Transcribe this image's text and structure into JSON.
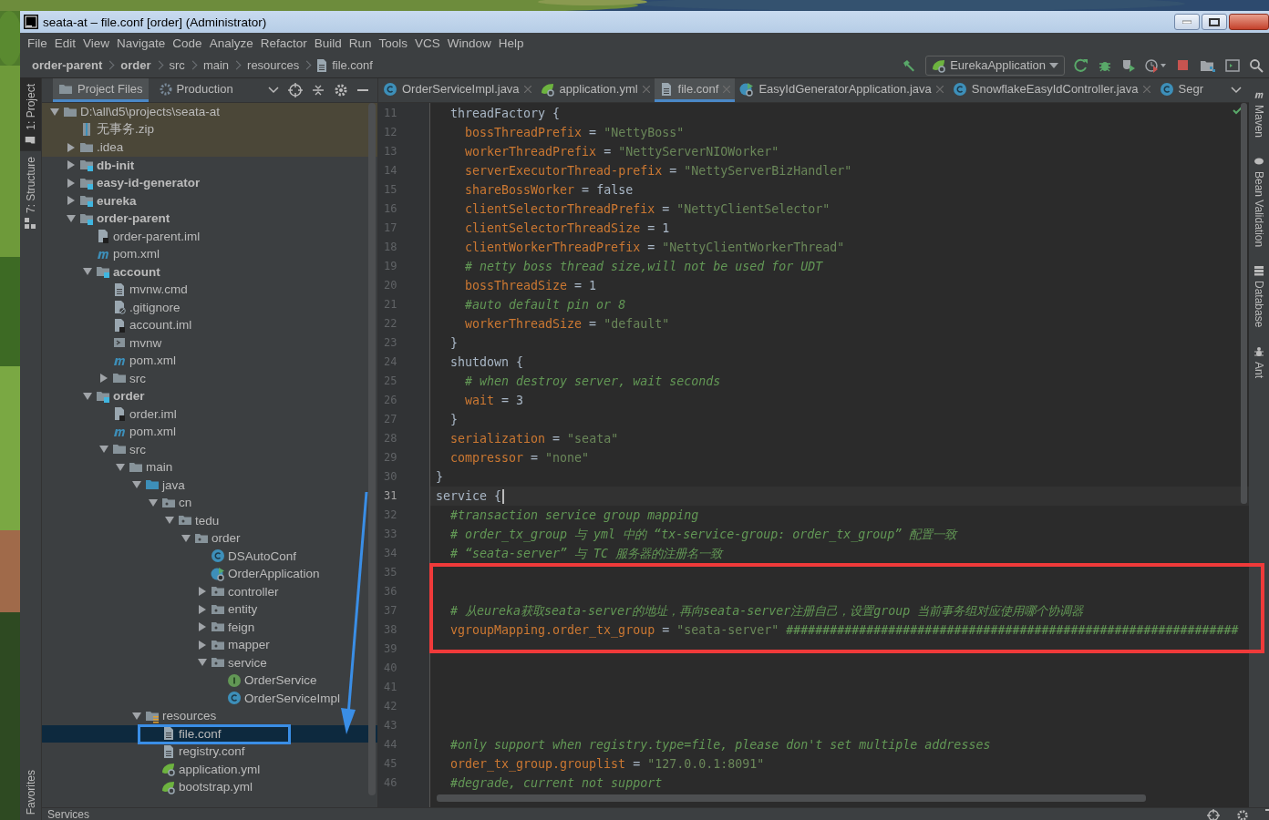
{
  "window": {
    "title": "seata-at – file.conf [order] (Administrator)"
  },
  "menu": [
    "File",
    "Edit",
    "View",
    "Navigate",
    "Code",
    "Analyze",
    "Refactor",
    "Build",
    "Run",
    "Tools",
    "VCS",
    "Window",
    "Help"
  ],
  "breadcrumbs": [
    {
      "label": "order-parent",
      "kind": "module"
    },
    {
      "label": "order",
      "kind": "module"
    },
    {
      "label": "src",
      "kind": "folder"
    },
    {
      "label": "main",
      "kind": "folder"
    },
    {
      "label": "resources",
      "kind": "folder"
    },
    {
      "label": "file.conf",
      "kind": "file"
    }
  ],
  "run_configuration": "EurekaApplication",
  "left_tool_strip": [
    {
      "label": "1: Project",
      "kind": "project",
      "selected": true
    },
    {
      "label": "7: Structure",
      "kind": "structure",
      "selected": false
    }
  ],
  "left_tool_strip_bottom": [
    {
      "label": "Favorites",
      "selected": false
    }
  ],
  "right_tool_strip": [
    {
      "label": "Maven",
      "kind": "maven"
    },
    {
      "label": "Bean Validation",
      "kind": "bean"
    },
    {
      "label": "Database",
      "kind": "database"
    },
    {
      "label": "Ant",
      "kind": "ant"
    }
  ],
  "project_panel": {
    "tabs": [
      {
        "label": "Project Files",
        "selected": true
      },
      {
        "label": "Production",
        "selected": false
      }
    ],
    "tree": [
      {
        "label": "D:\\all\\d5\\projects\\seata-at",
        "kind": "folder",
        "expanded": true,
        "highlighted": true,
        "selected": false,
        "children": [
          {
            "label": "无事务.zip",
            "kind": "zip",
            "highlighted": true,
            "selected": false
          },
          {
            "label": ".idea",
            "kind": "folder",
            "expanded": false,
            "highlighted": true,
            "selected": false
          },
          {
            "label": "db-init",
            "kind": "module",
            "expanded": false,
            "highlighted": false,
            "selected": false
          },
          {
            "label": "easy-id-generator",
            "kind": "module",
            "expanded": false,
            "highlighted": false,
            "selected": false
          },
          {
            "label": "eureka",
            "kind": "module",
            "expanded": false,
            "highlighted": false,
            "selected": false
          },
          {
            "label": "order-parent",
            "kind": "module",
            "expanded": true,
            "highlighted": false,
            "selected": false,
            "children": [
              {
                "label": "order-parent.iml",
                "kind": "iml",
                "highlighted": false,
                "selected": false
              },
              {
                "label": "pom.xml",
                "kind": "maven",
                "highlighted": false,
                "selected": false
              },
              {
                "label": "account",
                "kind": "module",
                "expanded": true,
                "highlighted": false,
                "selected": false,
                "children": [
                  {
                    "label": "mvnw.cmd",
                    "kind": "text",
                    "highlighted": false,
                    "selected": false
                  },
                  {
                    "label": ".gitignore",
                    "kind": "ignore",
                    "highlighted": false,
                    "selected": false
                  },
                  {
                    "label": "account.iml",
                    "kind": "iml",
                    "highlighted": false,
                    "selected": false
                  },
                  {
                    "label": "mvnw",
                    "kind": "script",
                    "highlighted": false,
                    "selected": false
                  },
                  {
                    "label": "pom.xml",
                    "kind": "maven",
                    "highlighted": false,
                    "selected": false
                  },
                  {
                    "label": "src",
                    "kind": "folder",
                    "expanded": false,
                    "highlighted": false,
                    "selected": false
                  }
                ]
              },
              {
                "label": "order",
                "kind": "module",
                "expanded": true,
                "highlighted": false,
                "selected": false,
                "children": [
                  {
                    "label": "order.iml",
                    "kind": "iml",
                    "highlighted": false,
                    "selected": false
                  },
                  {
                    "label": "pom.xml",
                    "kind": "maven",
                    "highlighted": false,
                    "selected": false
                  },
                  {
                    "label": "src",
                    "kind": "folder",
                    "expanded": true,
                    "highlighted": false,
                    "selected": false,
                    "children": [
                      {
                        "label": "main",
                        "kind": "folder",
                        "expanded": true,
                        "highlighted": false,
                        "selected": false,
                        "children": [
                          {
                            "label": "java",
                            "kind": "source",
                            "expanded": true,
                            "highlighted": false,
                            "selected": false,
                            "children": [
                              {
                                "label": "cn",
                                "kind": "package",
                                "expanded": true,
                                "highlighted": false,
                                "selected": false,
                                "children": [
                                  {
                                    "label": "tedu",
                                    "kind": "package",
                                    "expanded": true,
                                    "highlighted": false,
                                    "selected": false,
                                    "children": [
                                      {
                                        "label": "order",
                                        "kind": "package",
                                        "expanded": true,
                                        "highlighted": false,
                                        "selected": false,
                                        "children": [
                                          {
                                            "label": "DSAutoConf",
                                            "kind": "class",
                                            "highlighted": false,
                                            "selected": false
                                          },
                                          {
                                            "label": "OrderApplication",
                                            "kind": "app",
                                            "highlighted": false,
                                            "selected": false
                                          },
                                          {
                                            "label": "controller",
                                            "kind": "package",
                                            "expanded": false,
                                            "highlighted": false,
                                            "selected": false
                                          },
                                          {
                                            "label": "entity",
                                            "kind": "package",
                                            "expanded": false,
                                            "highlighted": false,
                                            "selected": false
                                          },
                                          {
                                            "label": "feign",
                                            "kind": "package",
                                            "expanded": false,
                                            "highlighted": false,
                                            "selected": false
                                          },
                                          {
                                            "label": "mapper",
                                            "kind": "package",
                                            "expanded": false,
                                            "highlighted": false,
                                            "selected": false
                                          },
                                          {
                                            "label": "service",
                                            "kind": "package",
                                            "expanded": true,
                                            "highlighted": false,
                                            "selected": false,
                                            "children": [
                                              {
                                                "label": "OrderService",
                                                "kind": "interface",
                                                "highlighted": false,
                                                "selected": false
                                              },
                                              {
                                                "label": "OrderServiceImpl",
                                                "kind": "class",
                                                "highlighted": false,
                                                "selected": false
                                              }
                                            ]
                                          }
                                        ]
                                      }
                                    ]
                                  }
                                ]
                              }
                            ]
                          },
                          {
                            "label": "resources",
                            "kind": "resources",
                            "expanded": true,
                            "highlighted": false,
                            "selected": false,
                            "children": [
                              {
                                "label": "file.conf",
                                "kind": "text",
                                "highlighted": false,
                                "selected": true
                              },
                              {
                                "label": "registry.conf",
                                "kind": "text",
                                "highlighted": false,
                                "selected": false
                              },
                              {
                                "label": "application.yml",
                                "kind": "spring",
                                "highlighted": false,
                                "selected": false
                              },
                              {
                                "label": "bootstrap.yml",
                                "kind": "spring",
                                "highlighted": false,
                                "selected": false
                              }
                            ]
                          }
                        ]
                      }
                    ]
                  }
                ]
              }
            ]
          }
        ]
      }
    ]
  },
  "editor": {
    "tabs": [
      {
        "label": "OrderServiceImpl.java",
        "kind": "class",
        "selected": false,
        "closable": true
      },
      {
        "label": "application.yml",
        "kind": "spring",
        "selected": false,
        "closable": true
      },
      {
        "label": "file.conf",
        "kind": "text",
        "selected": true,
        "closable": true
      },
      {
        "label": "EasyIdGeneratorApplication.java",
        "kind": "app",
        "selected": false,
        "closable": true
      },
      {
        "label": "SnowflakeEasyIdController.java",
        "kind": "class",
        "selected": false,
        "closable": true
      },
      {
        "label": "Segr",
        "kind": "class",
        "selected": false,
        "closable": false
      }
    ],
    "lines": [
      {
        "number": "11",
        "current": false,
        "segments": [
          {
            "kind": "plain",
            "text": "  threadFactory {"
          }
        ]
      },
      {
        "number": "12",
        "current": false,
        "segments": [
          {
            "kind": "key",
            "text": "    bossThreadPrefix"
          },
          {
            "kind": "plain",
            "text": " = "
          },
          {
            "kind": "string",
            "text": "\"NettyBoss\""
          }
        ]
      },
      {
        "number": "13",
        "current": false,
        "segments": [
          {
            "kind": "key",
            "text": "    workerThreadPrefix"
          },
          {
            "kind": "plain",
            "text": " = "
          },
          {
            "kind": "string",
            "text": "\"NettyServerNIOWorker\""
          }
        ]
      },
      {
        "number": "14",
        "current": false,
        "segments": [
          {
            "kind": "key",
            "text": "    serverExecutorThread-prefix"
          },
          {
            "kind": "plain",
            "text": " = "
          },
          {
            "kind": "string",
            "text": "\"NettyServerBizHandler\""
          }
        ]
      },
      {
        "number": "15",
        "current": false,
        "segments": [
          {
            "kind": "key",
            "text": "    shareBossWorker"
          },
          {
            "kind": "plain",
            "text": " = false"
          }
        ]
      },
      {
        "number": "16",
        "current": false,
        "segments": [
          {
            "kind": "key",
            "text": "    clientSelectorThreadPrefix"
          },
          {
            "kind": "plain",
            "text": " = "
          },
          {
            "kind": "string",
            "text": "\"NettyClientSelector\""
          }
        ]
      },
      {
        "number": "17",
        "current": false,
        "segments": [
          {
            "kind": "key",
            "text": "    clientSelectorThreadSize"
          },
          {
            "kind": "plain",
            "text": " = 1"
          }
        ]
      },
      {
        "number": "18",
        "current": false,
        "segments": [
          {
            "kind": "key",
            "text": "    clientWorkerThreadPrefix"
          },
          {
            "kind": "plain",
            "text": " = "
          },
          {
            "kind": "string",
            "text": "\"NettyClientWorkerThread\""
          }
        ]
      },
      {
        "number": "19",
        "current": false,
        "segments": [
          {
            "kind": "comment",
            "text": "    # netty boss thread size,will not be used for UDT"
          }
        ]
      },
      {
        "number": "20",
        "current": false,
        "segments": [
          {
            "kind": "key",
            "text": "    bossThreadSize"
          },
          {
            "kind": "plain",
            "text": " = 1"
          }
        ]
      },
      {
        "number": "21",
        "current": false,
        "segments": [
          {
            "kind": "comment",
            "text": "    #auto default pin or 8"
          }
        ]
      },
      {
        "number": "22",
        "current": false,
        "segments": [
          {
            "kind": "key",
            "text": "    workerThreadSize"
          },
          {
            "kind": "plain",
            "text": " = "
          },
          {
            "kind": "string",
            "text": "\"default\""
          }
        ]
      },
      {
        "number": "23",
        "current": false,
        "segments": [
          {
            "kind": "plain",
            "text": "  }"
          }
        ]
      },
      {
        "number": "24",
        "current": false,
        "segments": [
          {
            "kind": "plain",
            "text": "  shutdown {"
          }
        ]
      },
      {
        "number": "25",
        "current": false,
        "segments": [
          {
            "kind": "comment",
            "text": "    # when destroy server, wait seconds"
          }
        ]
      },
      {
        "number": "26",
        "current": false,
        "segments": [
          {
            "kind": "key",
            "text": "    wait"
          },
          {
            "kind": "plain",
            "text": " = 3"
          }
        ]
      },
      {
        "number": "27",
        "current": false,
        "segments": [
          {
            "kind": "plain",
            "text": "  }"
          }
        ]
      },
      {
        "number": "28",
        "current": false,
        "segments": [
          {
            "kind": "key",
            "text": "  serialization"
          },
          {
            "kind": "plain",
            "text": " = "
          },
          {
            "kind": "string",
            "text": "\"seata\""
          }
        ]
      },
      {
        "number": "29",
        "current": false,
        "segments": [
          {
            "kind": "key",
            "text": "  compressor"
          },
          {
            "kind": "plain",
            "text": " = "
          },
          {
            "kind": "string",
            "text": "\"none\""
          }
        ]
      },
      {
        "number": "30",
        "current": false,
        "segments": [
          {
            "kind": "plain",
            "text": "}"
          }
        ]
      },
      {
        "number": "31",
        "current": true,
        "segments": [
          {
            "kind": "plain",
            "text": "service {"
          }
        ]
      },
      {
        "number": "32",
        "current": false,
        "segments": [
          {
            "kind": "comment",
            "text": "  #transaction service group mapping"
          }
        ]
      },
      {
        "number": "33",
        "current": false,
        "segments": [
          {
            "kind": "comment",
            "text": "  # order_tx_group 与 yml 中的 “tx-service-group: order_tx_group” 配置一致"
          }
        ]
      },
      {
        "number": "34",
        "current": false,
        "segments": [
          {
            "kind": "comment",
            "text": "  # “seata-server” 与 TC 服务器的注册名一致"
          }
        ]
      },
      {
        "number": "35",
        "current": false
      },
      {
        "number": "36",
        "current": false
      },
      {
        "number": "37",
        "current": false,
        "segments": [
          {
            "kind": "comment",
            "text": "  # 从eureka获取seata-server的地址，再向seata-server注册自己，设置group 当前事务组对应使用哪个协调器"
          }
        ]
      },
      {
        "number": "38",
        "current": false,
        "segments": [
          {
            "kind": "key",
            "text": "  vgroupMapping.order_tx_group"
          },
          {
            "kind": "plain",
            "text": " = "
          },
          {
            "kind": "string",
            "text": "\"seata-server\""
          },
          {
            "kind": "comment",
            "text": " ##############################################################"
          }
        ]
      },
      {
        "number": "39",
        "current": false
      },
      {
        "number": "40",
        "current": false
      },
      {
        "number": "41",
        "current": false
      },
      {
        "number": "42",
        "current": false
      },
      {
        "number": "43",
        "current": false
      },
      {
        "number": "44",
        "current": false,
        "segments": [
          {
            "kind": "comment",
            "text": "  #only support when registry.type=file, please don't set multiple addresses"
          }
        ]
      },
      {
        "number": "45",
        "current": false,
        "segments": [
          {
            "kind": "key",
            "text": "  order_tx_group.grouplist"
          },
          {
            "kind": "plain",
            "text": " = "
          },
          {
            "kind": "string",
            "text": "\"127.0.0.1:8091\""
          }
        ]
      },
      {
        "number": "46",
        "current": false,
        "segments": [
          {
            "kind": "comment",
            "text": "  #degrade, current not support"
          }
        ]
      }
    ]
  },
  "services_bar": {
    "title": "Services"
  }
}
